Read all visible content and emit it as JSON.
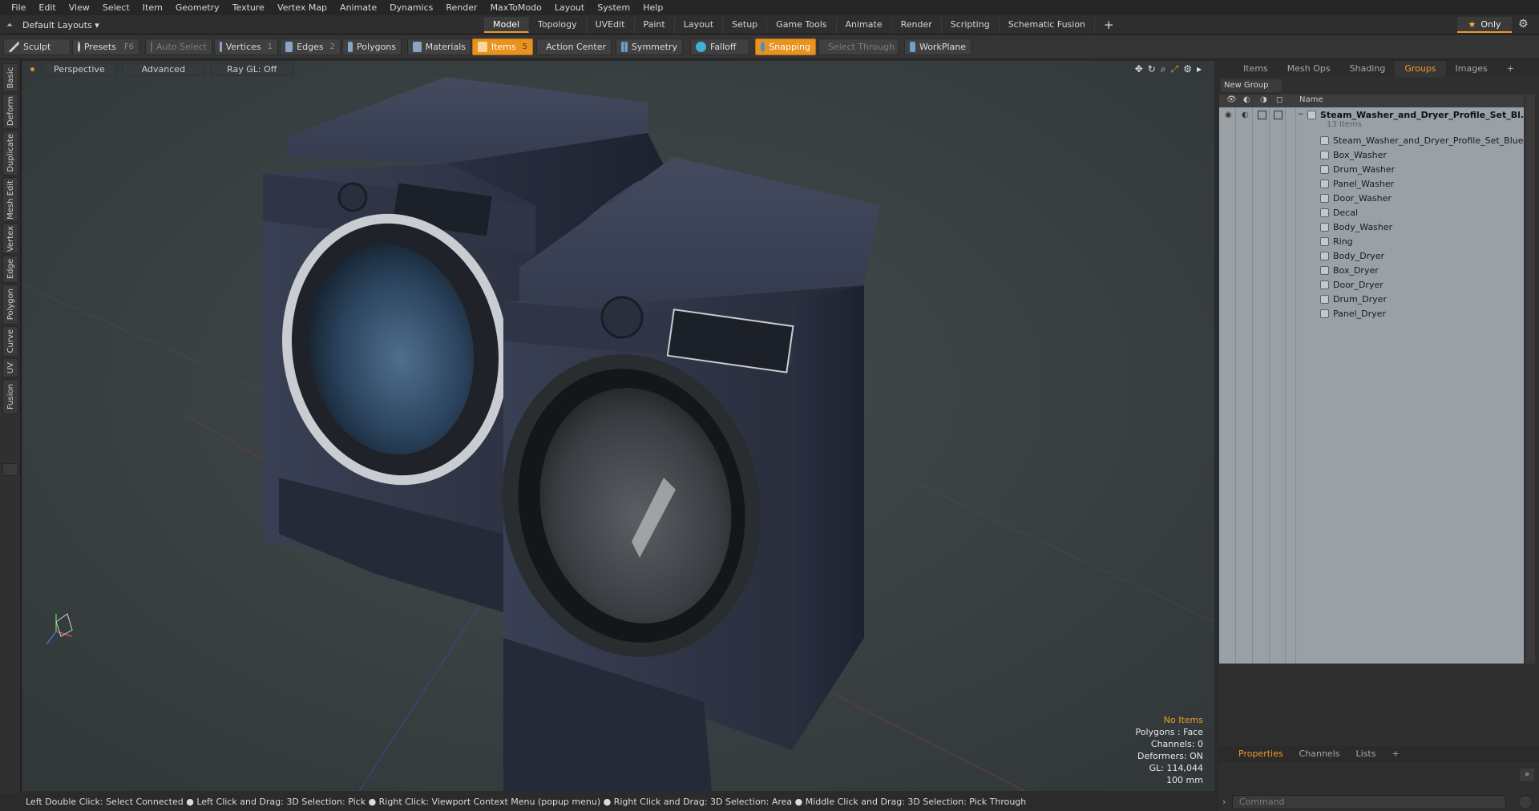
{
  "menu": [
    "File",
    "Edit",
    "View",
    "Select",
    "Item",
    "Geometry",
    "Texture",
    "Vertex Map",
    "Animate",
    "Dynamics",
    "Render",
    "MaxToModo",
    "Layout",
    "System",
    "Help"
  ],
  "layout_selector": "Default Layouts ▾",
  "mode_tabs": [
    "Model",
    "Topology",
    "UVEdit",
    "Paint",
    "Layout",
    "Setup",
    "Game Tools",
    "Animate",
    "Render",
    "Scripting",
    "Schematic Fusion"
  ],
  "mode_tab_plus": "+",
  "only_label": "Only",
  "toolbar": {
    "sculpt": "Sculpt",
    "presets": "Presets",
    "presets_key": "F6",
    "auto_select": "Auto Select",
    "vertices": "Vertices",
    "vertices_num": "1",
    "edges": "Edges",
    "edges_num": "2",
    "polygons": "Polygons",
    "materials": "Materials",
    "items": "Items",
    "items_num": "5",
    "action_center": "Action Center",
    "symmetry": "Symmetry",
    "falloff": "Falloff",
    "snapping": "Snapping",
    "select_through": "Select Through",
    "workplane": "WorkPlane"
  },
  "left_tabs": [
    "Basic",
    "Deform",
    "Duplicate",
    "Mesh Edit",
    "Vertex",
    "Edge",
    "Polygon",
    "Curve",
    "UV",
    "Fusion"
  ],
  "viewport": {
    "view_mode": "Perspective",
    "shading": "Advanced",
    "raygl": "Ray GL: Off",
    "info": {
      "no_items": "No Items",
      "polygons": "Polygons : Face",
      "channels": "Channels: 0",
      "deformers": "Deformers: ON",
      "gl": "GL: 114,044",
      "units": "100 mm"
    }
  },
  "status_bar": "Left Double Click: Select Connected ● Left Click and Drag: 3D Selection: Pick ● Right Click: Viewport Context Menu (popup menu) ● Right Click and Drag: 3D Selection: Area ● Middle Click and Drag: 3D Selection: Pick Through",
  "right_panel": {
    "tabs": [
      "Items",
      "Mesh Ops",
      "Shading",
      "Groups",
      "Images"
    ],
    "tab_plus": "+",
    "new_group": "New Group",
    "column_name": "Name",
    "root_item": "Steam_Washer_and_Dryer_Profile_Set_Bl...",
    "root_count": "13 Items",
    "items": [
      "Steam_Washer_and_Dryer_Profile_Set_Blue",
      "Box_Washer",
      "Drum_Washer",
      "Panel_Washer",
      "Door_Washer",
      "Decal",
      "Body_Washer",
      "Ring",
      "Body_Dryer",
      "Box_Dryer",
      "Door_Dryer",
      "Drum_Dryer",
      "Panel_Dryer"
    ],
    "bottom_tabs": [
      "Properties",
      "Channels",
      "Lists"
    ],
    "bottom_plus": "+",
    "command_placeholder": "Command"
  },
  "colors": {
    "accent": "#e8921f",
    "viewport_bg": "#3a4142",
    "appliance": "#2f3547"
  }
}
